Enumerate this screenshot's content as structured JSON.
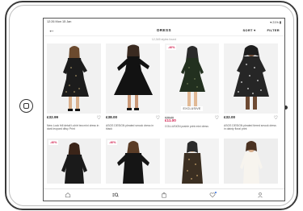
{
  "status": {
    "time_date": "12:26  Mon 15 Jan",
    "battery": "▾ 21% ▮"
  },
  "nav": {
    "title": "DRESS",
    "sort_label": "SORT ▾",
    "filter_label": "FILTER"
  },
  "results_count": "12,345 styles found",
  "products": [
    {
      "price": "£32.99",
      "desc": "New Look frill detail t-shirt tea mini dress in dark leopard ditsy Print",
      "badge": "",
      "old_price": "",
      "sale_price": "",
      "exclusive": ""
    },
    {
      "price": "£38.00",
      "desc": "ASOS DESIGN pleated smock dress in black",
      "badge": "",
      "old_price": "",
      "sale_price": "",
      "exclusive": ""
    },
    {
      "price": "",
      "desc": "COLLUSION prairie print mini dress",
      "badge": "-40%",
      "old_price": "£28.00",
      "sale_price": "£11.00",
      "exclusive": "EXCLUSIVE"
    },
    {
      "price": "£32.00",
      "desc": "ASOS DESIGN pleated tiered smock dress in dainty floral print",
      "badge": "",
      "old_price": "",
      "sale_price": "",
      "exclusive": ""
    },
    {
      "badge": "-40%"
    },
    {
      "badge": "-40%"
    },
    {
      "badge": ""
    },
    {
      "badge": ""
    }
  ],
  "icons": {
    "back": "arrow-left-icon",
    "heart": "heart-outline-icon",
    "tabs": [
      "home-icon",
      "search-icon",
      "bag-icon",
      "saved-heart-icon",
      "account-icon"
    ]
  },
  "colors": {
    "sale": "#d01345",
    "accent": "#2d6cdf"
  }
}
